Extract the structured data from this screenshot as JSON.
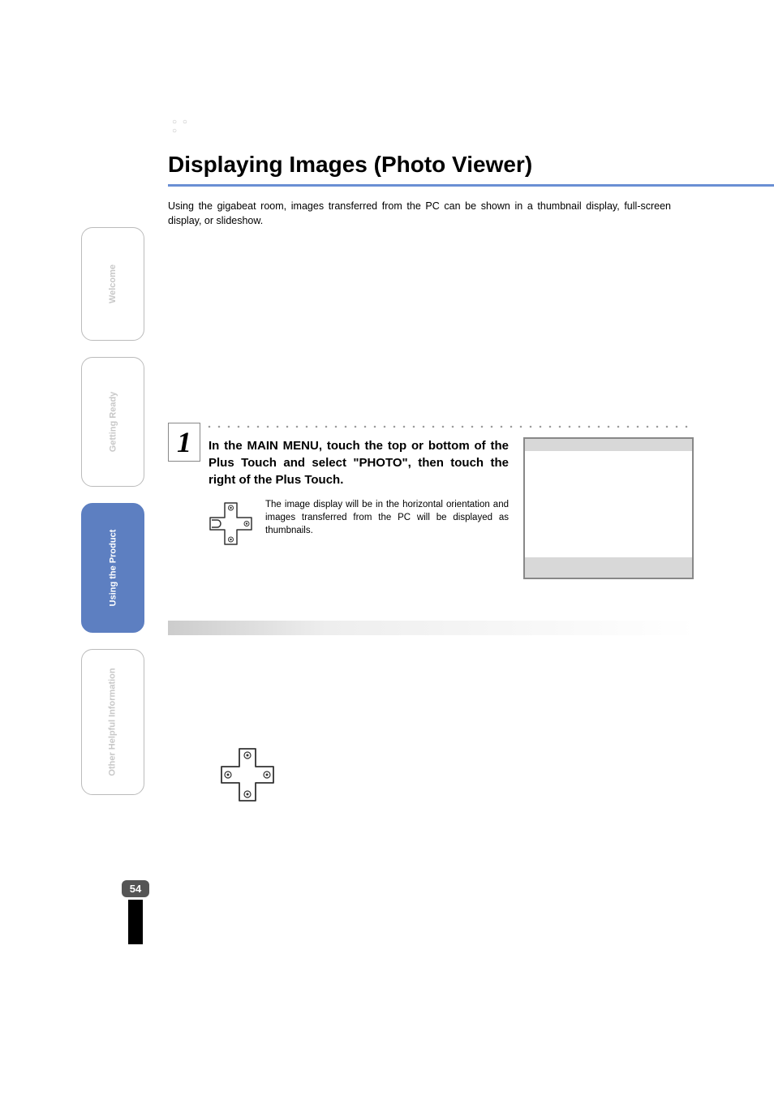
{
  "section": {
    "title": "Displaying Images (Photo Viewer)",
    "intro": "Using the gigabeat room, images transferred from the PC can be shown in a thumbnail display, full-screen display, or slideshow."
  },
  "step1": {
    "number": "1",
    "heading": "In the MAIN MENU, touch the top or bottom of the Plus Touch and select \"PHOTO\", then touch the right of the Plus Touch.",
    "detail": "The image display will be in the horizontal orientation and images transferred from the PC will be displayed as thumbnails."
  },
  "sideTabs": [
    {
      "label": "Welcome",
      "active": false
    },
    {
      "label": "Getting Ready",
      "active": false
    },
    {
      "label": "Using the Product",
      "active": true
    },
    {
      "label": "Other Helpful Information",
      "active": false
    }
  ],
  "pageNumber": "54"
}
